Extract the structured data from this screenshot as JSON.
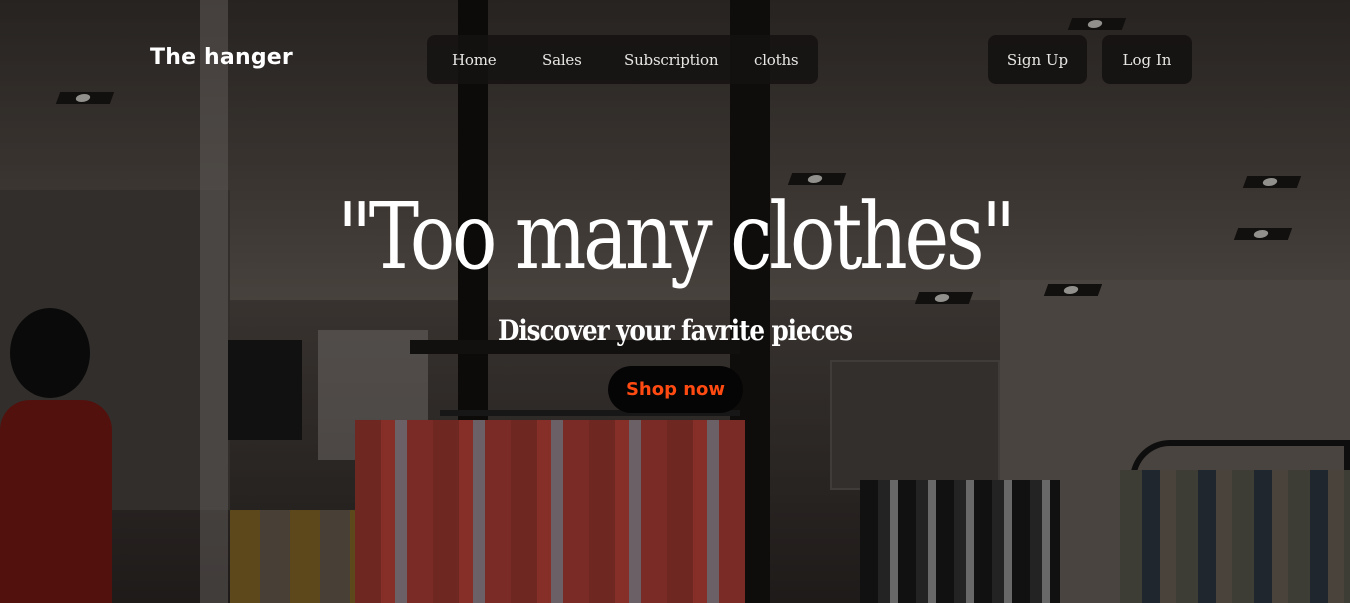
{
  "brand": {
    "name": "The hanger"
  },
  "nav": {
    "items": [
      {
        "label": "Home"
      },
      {
        "label": "Sales"
      },
      {
        "label": "Subscription"
      },
      {
        "label": "cloths"
      }
    ]
  },
  "auth": {
    "signup_label": "Sign Up",
    "login_label": "Log In"
  },
  "hero": {
    "title": "\"Too many clothes\"",
    "subtitle": "Discover your favrite pieces",
    "cta_label": "Shop now"
  },
  "colors": {
    "accent": "#ff4a12",
    "nav_bg": "#141211",
    "text": "#ffffff"
  }
}
